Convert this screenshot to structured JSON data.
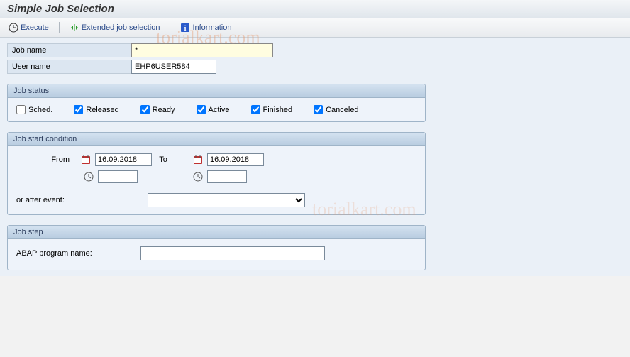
{
  "header": {
    "title": "Simple Job Selection"
  },
  "toolbar": {
    "execute": "Execute",
    "extended": "Extended job selection",
    "info": "Information"
  },
  "fields": {
    "job_name_label": "Job name",
    "job_name_value": "*",
    "user_name_label": "User name",
    "user_name_value": "EHP6USER584"
  },
  "groups": {
    "status": {
      "title": "Job status",
      "sched": "Sched.",
      "released": "Released",
      "ready": "Ready",
      "active": "Active",
      "finished": "Finished",
      "canceled": "Canceled"
    },
    "start": {
      "title": "Job start condition",
      "from": "From",
      "to": "To",
      "date_from": "16.09.2018",
      "date_to": "16.09.2018",
      "time_from": "",
      "time_to": "",
      "event_label": "or after event:",
      "event_value": ""
    },
    "step": {
      "title": "Job step",
      "abap_label": "ABAP program name:",
      "abap_value": ""
    }
  },
  "watermark": "torialkart.com",
  "watermark2": "torialkart.com"
}
